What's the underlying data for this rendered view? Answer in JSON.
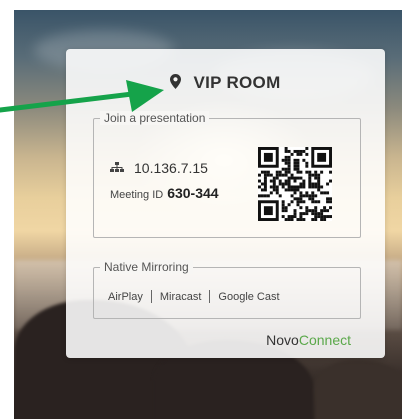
{
  "room": {
    "title": "VIP ROOM",
    "pin_icon": "location-pin-icon"
  },
  "join": {
    "legend": "Join a presentation",
    "ip_icon": "network-icon",
    "ip_address": "10.136.7.15",
    "meeting_label": "Meeting ID",
    "meeting_id": "630-344",
    "qr_icon": "qr-code-icon"
  },
  "mirroring": {
    "legend": "Native Mirroring",
    "options": [
      "AirPlay",
      "Miracast",
      "Google Cast"
    ]
  },
  "brand": {
    "part1": "Novo",
    "part2": "Connect",
    "part2_color": "#5aa84a"
  },
  "annotation": {
    "arrow_color": "#15a34a",
    "arrow_icon": "arrow-right-icon"
  }
}
